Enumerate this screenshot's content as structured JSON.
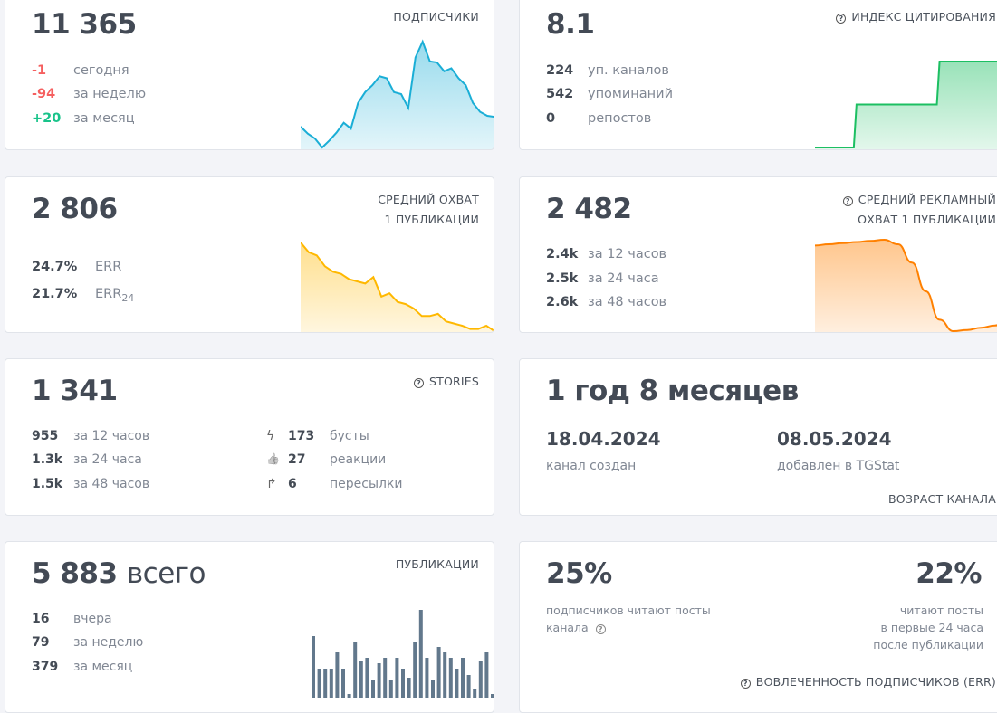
{
  "subscribers": {
    "value": "11 365",
    "label": "ПОДПИСЧИКИ",
    "rows": [
      {
        "n": "-1",
        "t": "сегодня"
      },
      {
        "n": "-94",
        "t": "за неделю"
      },
      {
        "n": "+20",
        "t": "за месяц"
      }
    ],
    "color": "#1aaed6",
    "spark": [
      25,
      18,
      13,
      4,
      11,
      19,
      29,
      23,
      49,
      60,
      67,
      76,
      74,
      60,
      58,
      44,
      95,
      111,
      91,
      90,
      81,
      84,
      74,
      67,
      49,
      40,
      36,
      35
    ]
  },
  "citation": {
    "value": "8.1",
    "label": "ИНДЕКС ЦИТИРОВАНИЯ",
    "rows": [
      {
        "n": "224",
        "t": "уп. каналов"
      },
      {
        "n": "542",
        "t": "упоминаний"
      },
      {
        "n": "0",
        "t": "репостов"
      }
    ],
    "color": "#1cbf62",
    "spark": [
      0,
      0,
      0,
      50,
      50,
      50,
      50,
      50,
      50,
      100,
      100,
      100,
      100,
      100,
      100
    ]
  },
  "reach": {
    "value": "2 806",
    "label1": "СРЕДНИЙ ОХВАТ",
    "label2": "1 ПУБЛИКАЦИИ",
    "rows": [
      {
        "n": "24.7%",
        "t": "ERR",
        "sub": ""
      },
      {
        "n": "21.7%",
        "t": "ERR",
        "sub": "24"
      }
    ],
    "color": "#ffb800",
    "spark": [
      98,
      89,
      86,
      76,
      71,
      69,
      64,
      62,
      60,
      66,
      48,
      51,
      43,
      41,
      37,
      30,
      30,
      32,
      25,
      23,
      21,
      18,
      18,
      21,
      16
    ]
  },
  "ad_reach": {
    "value": "2 482",
    "label1": "СРЕДНИЙ РЕКЛАМНЫЙ",
    "label2": "ОХВАТ 1 ПУБЛИКАЦИИ",
    "rows": [
      {
        "n": "2.4k",
        "t": "за 12 часов"
      },
      {
        "n": "2.5k",
        "t": "за 24 часа"
      },
      {
        "n": "2.6k",
        "t": "за 48 часов"
      }
    ],
    "color": "#ff8000",
    "spark": [
      95,
      96,
      97,
      98,
      99,
      100,
      96,
      80,
      55,
      30,
      20,
      21,
      23,
      25,
      28
    ]
  },
  "stories": {
    "value": "1 341",
    "label": "STORIES",
    "rows": [
      {
        "n": "955",
        "t": "за 12 часов"
      },
      {
        "n": "1.3k",
        "t": "за 24 часа"
      },
      {
        "n": "1.5k",
        "t": "за 48 часов"
      }
    ],
    "extra": [
      {
        "icon": "lightning-icon",
        "glyph": "ϟ",
        "n": "173",
        "t": "бусты"
      },
      {
        "icon": "thumbs-up-icon",
        "glyph": "👍",
        "n": "27",
        "t": "реакции"
      },
      {
        "icon": "share-arrow-icon",
        "glyph": "↱",
        "n": "6",
        "t": "пересылки"
      }
    ]
  },
  "age": {
    "value": "1 год 8 месяцев",
    "created_date": "18.04.2024",
    "created_label": "канал создан",
    "added_date": "08.05.2024",
    "added_label": "добавлен в TGStat",
    "label": "ВОЗРАСТ КАНАЛА"
  },
  "posts": {
    "value": "5 883",
    "suffix": "всего",
    "label": "ПУБЛИКАЦИИ",
    "rows": [
      {
        "n": "16",
        "t": "вчера"
      },
      {
        "n": "79",
        "t": "за неделю"
      },
      {
        "n": "379",
        "t": "за месяц"
      }
    ],
    "color": "#62788c",
    "bars": [
      68,
      32,
      32,
      32,
      50,
      32,
      4,
      62,
      41,
      44,
      19,
      38,
      44,
      19,
      44,
      32,
      22,
      62,
      97,
      44,
      19,
      56,
      50,
      44,
      32,
      44,
      25,
      10,
      41,
      50,
      4
    ]
  },
  "engagement": {
    "left_value": "25%",
    "left_text1": "подписчиков читают посты",
    "left_text2": "канала",
    "right_value": "22%",
    "right_text1": "читают посты",
    "right_text2": "в первые 24 часа",
    "right_text3": "после публикации",
    "label": "ВОВЛЕЧЕННОСТЬ ПОДПИСЧИКОВ (ERR)"
  }
}
